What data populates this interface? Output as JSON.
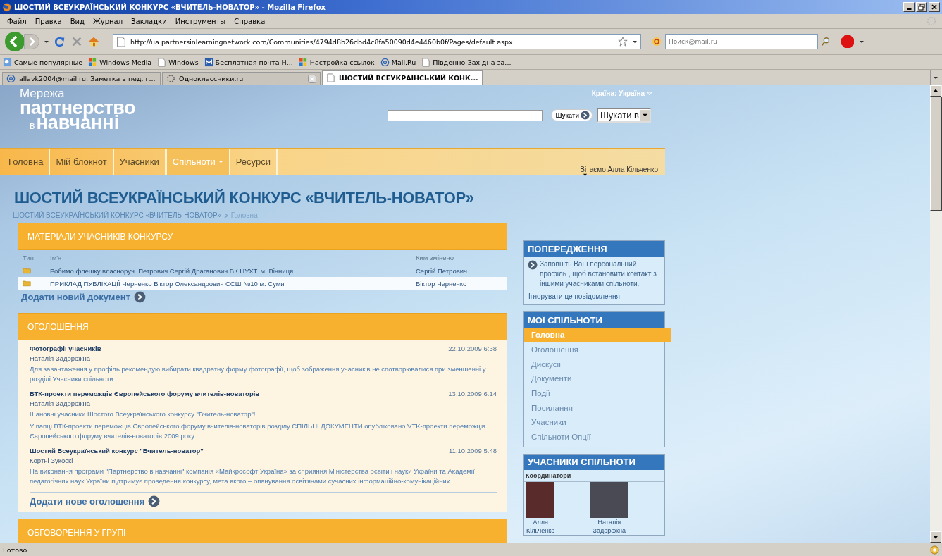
{
  "window": {
    "title": "ШОСТИЙ ВСЕУКРАЇНСЬКИЙ КОНКУРС «ВЧИТЕЛЬ-НОВАТОР» - Mozilla Firefox"
  },
  "menu_bar": [
    "Файл",
    "Правка",
    "Вид",
    "Журнал",
    "Закладки",
    "Инструменты",
    "Справка"
  ],
  "toolbar": {
    "url": "http://ua.partnersinlearningnetwork.com/Communities/4794d8b26dbd4c8fa50090d4e4460b0f/Pages/default.aspx",
    "search_placeholder": "Поиск@mail.ru"
  },
  "bookmarks": [
    {
      "label": "Самые популярные",
      "kind": "search"
    },
    {
      "label": "Windows Media",
      "kind": "windows"
    },
    {
      "label": "Windows",
      "kind": "page"
    },
    {
      "label": "Бесплатная почта Н...",
      "kind": "mail"
    },
    {
      "label": "Настройка ссылок",
      "kind": "windows"
    },
    {
      "label": "Mail.Ru",
      "kind": "at"
    },
    {
      "label": "Південно-Західна за...",
      "kind": "page"
    }
  ],
  "tabs": [
    {
      "label": "allavk2004@mail.ru: Заметка в пед. г...",
      "kind": "at",
      "selected": false
    },
    {
      "label": "Одноклассники.ru",
      "kind": "loading",
      "selected": false
    },
    {
      "label": "ШОСТИЙ ВСЕУКРАЇНСЬКИЙ КОНК...",
      "kind": "page",
      "selected": true
    }
  ],
  "page": {
    "logo": {
      "line_1": "Мережа",
      "line_2": "партнерство",
      "small": "в",
      "line_3": "навчанні"
    },
    "country": "Країна: Україна",
    "search_button": "Шукати",
    "search_scope": "Шукати в",
    "nav": [
      {
        "label": "Головна",
        "selected": false,
        "has_menu": false
      },
      {
        "label": "Мій блокнот",
        "selected": false,
        "has_menu": false
      },
      {
        "label": "Учасники",
        "selected": false,
        "has_menu": false
      },
      {
        "label": "Спільноти",
        "selected": true,
        "has_menu": true
      },
      {
        "label": "Ресурси",
        "selected": false,
        "has_menu": false
      }
    ],
    "greeting": "Вітаємо Алла Кільченко",
    "heading": "ШОСТИЙ ВСЕУКРАЇНСЬКИЙ КОНКУРС «ВЧИТЕЛЬ-НОВАТОР»",
    "breadcrumb": [
      "ШОСТИЙ ВСЕУКРАЇНСЬКИЙ КОНКУРС «ВЧИТЕЛЬ-НОВАТОР»",
      "Головна"
    ],
    "documents": {
      "title": "МАТЕРІАЛИ УЧАСНИКІВ КОНКУРСУ",
      "columns": [
        "Тип",
        "Ім'я",
        "Ким змінено"
      ],
      "rows": [
        {
          "name": "Робимо флешку власноруч. Петрович Сергій Драганович ВК НУХТ. м. Вінниця",
          "modified_by": "Сергій Петрович",
          "selected": false
        },
        {
          "name": "ПРИКЛАД ПУБЛІКАЦІЇ Черненко Віктор Олександрович ССШ №10 м. Суми",
          "modified_by": "Віктор Черненко",
          "selected": true
        }
      ],
      "add_link": "Додати новий документ"
    },
    "announcements": {
      "title": "ОГОЛОШЕННЯ",
      "items": [
        {
          "title": "Фотографії учасників",
          "author": "Наталія Задорожна",
          "date": "22.10.2009 6:38",
          "body": [
            "Для завантаження у профіль рекомендую вибирати квадратну форму фотографії, щоб зображення учасників не спотворювалися при зменшенні у розділі Учасники спільноти"
          ]
        },
        {
          "title": "ВТК-проекти переможців Європейського форуму вчителів-новаторів",
          "author": "Наталія Задорожна",
          "date": "13.10.2009 6:14",
          "body": [
            "Шановні учасники Шостого Всеукраїнського конкурсу \"Вчитель-новатор\"!",
            "У папці ВТК-проекти переможців Європейського форуму вчителів-новаторів розділу СПІЛЬНІ ДОКУМЕНТИ опубліковано VTK-проекти переможців Європейського форуму вчителів-новаторів 2009 року...."
          ]
        },
        {
          "title": "Шостий Всеукраїнський конкурс \"Вчитель-новатор\"",
          "author": "Кортні Зукоскі",
          "date": "11.10.2009 5:48",
          "body": [
            "На виконання програми \"Партнерство в навчанні\" компанія «Майкрософт Україна» за сприяння Міністерства освіти і науки України та Академії педагогічних наук України підтримує проведення конкурсу, мета якого – опанування освітянами сучасних інформаційно-комунікаційних..."
          ]
        }
      ],
      "add_link": "Додати нове оголошення"
    },
    "discussion": {
      "title": "ОБГОВОРЕННЯ У ГРУПІ"
    },
    "warning": {
      "title": "ПОПЕРЕДЖЕННЯ",
      "text": "Заповніть Ваш персональний профіль , щоб встановити контакт з іншими учасниками спільноти.",
      "ignore_link": "Ігнорувати це повідомлення"
    },
    "communities": {
      "title": "МОЇ СПІЛЬНОТИ",
      "items": [
        {
          "label": "Головна",
          "selected": true
        },
        {
          "label": "Оголошення",
          "selected": false
        },
        {
          "label": "Дискусії",
          "selected": false
        },
        {
          "label": "Документи",
          "selected": false
        },
        {
          "label": "Події",
          "selected": false
        },
        {
          "label": "Посилання",
          "selected": false
        },
        {
          "label": "Учасники",
          "selected": false
        },
        {
          "label": "Спільноти Опції",
          "selected": false
        }
      ]
    },
    "members": {
      "title": "УЧАСНИКИ СПІЛЬНОТИ",
      "section": "Координатори",
      "people": [
        {
          "first": "Алла",
          "last": "Кільченко"
        },
        {
          "first": "Наталія",
          "last": "Задорожна"
        }
      ]
    }
  },
  "status_bar": "Готово"
}
